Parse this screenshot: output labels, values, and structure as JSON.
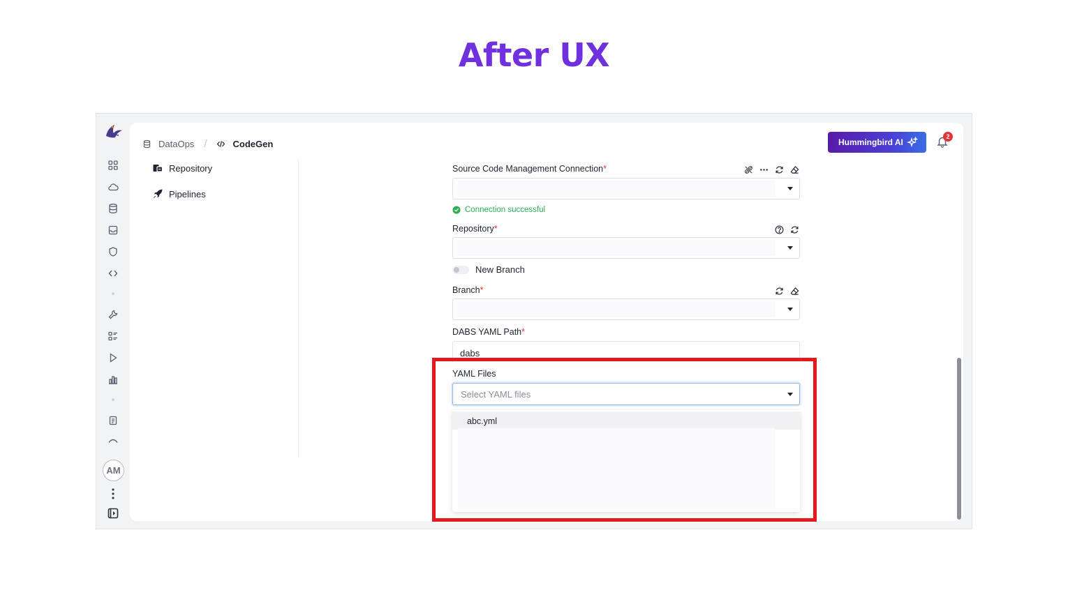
{
  "slide": {
    "title": "After UX"
  },
  "rail": {
    "avatar_initials": "AM",
    "icons": [
      "dashboard-icon",
      "cloud-icon",
      "database-icon",
      "inbox-icon",
      "shield-icon",
      "code-icon",
      "wrench-icon",
      "list-icon",
      "play-icon",
      "bar-chart-icon",
      "clipboard-icon",
      "eye-icon"
    ]
  },
  "breadcrumb": {
    "item1": "DataOps",
    "item2": "CodeGen",
    "separator": "/"
  },
  "header": {
    "assistant_label": "Hummingbird AI",
    "notification_count": "2",
    "accent": "#5a1aa8"
  },
  "subnav": {
    "items": [
      {
        "label": "Repository",
        "icon": "repository-icon"
      },
      {
        "label": "Pipelines",
        "icon": "rocket-icon"
      }
    ]
  },
  "form": {
    "scm": {
      "label": "Source Code Management Connection",
      "required": "*",
      "status": "Connection successful"
    },
    "repository": {
      "label": "Repository",
      "required": "*"
    },
    "new_branch": {
      "label": "New Branch",
      "enabled": false
    },
    "branch": {
      "label": "Branch",
      "required": "*"
    },
    "dabs_path": {
      "label": "DABS YAML Path",
      "required": "*",
      "value": "dabs"
    },
    "yaml_files": {
      "label": "YAML Files",
      "placeholder": "Select YAML files",
      "options": [
        "abc.yml"
      ]
    }
  },
  "colors": {
    "highlight": "#e4181d",
    "success": "#2fae55",
    "title": "#7030e0"
  }
}
